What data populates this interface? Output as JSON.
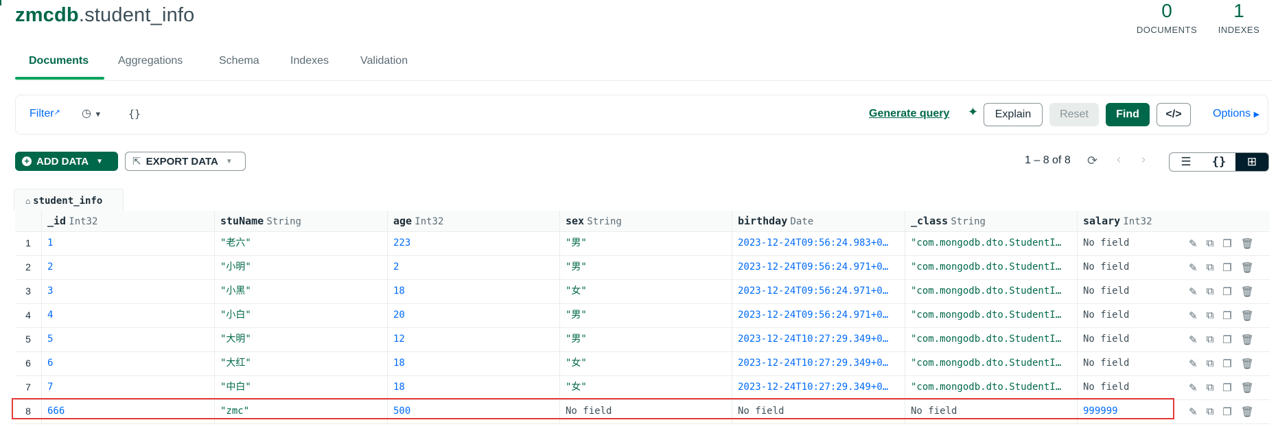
{
  "namespace": {
    "db": "zmcdb",
    "collection": ".student_info"
  },
  "stats": [
    {
      "value": "0",
      "label": "DOCUMENTS"
    },
    {
      "value": "1",
      "label": "INDEXES"
    }
  ],
  "tabs": [
    "Documents",
    "Aggregations",
    "Schema",
    "Indexes",
    "Validation"
  ],
  "query_bar": {
    "filter_label": "Filter",
    "query_text": "{}",
    "generate_label": "Generate query",
    "explain_label": "Explain",
    "reset_label": "Reset",
    "find_label": "Find",
    "code_label": "</>",
    "options_label": "Options"
  },
  "actions": {
    "add_data": "ADD DATA",
    "export_data": "EXPORT DATA",
    "pagination": "1 – 8 of 8"
  },
  "collection_tab": "student_info",
  "columns": [
    {
      "name": "_id",
      "type": "Int32"
    },
    {
      "name": "stuName",
      "type": "String"
    },
    {
      "name": "age",
      "type": "Int32"
    },
    {
      "name": "sex",
      "type": "String"
    },
    {
      "name": "birthday",
      "type": "Date"
    },
    {
      "name": "_class",
      "type": "String"
    },
    {
      "name": "salary",
      "type": "Int32"
    }
  ],
  "rows": [
    {
      "n": "1",
      "id": "1",
      "stuName": "\"老六\"",
      "age": "223",
      "sex": "\"男\"",
      "birthday": "2023-12-24T09:56:24.983+0…",
      "class": "\"com.mongodb.dto.StudentI…",
      "salary": "No field"
    },
    {
      "n": "2",
      "id": "2",
      "stuName": "\"小明\"",
      "age": "2",
      "sex": "\"男\"",
      "birthday": "2023-12-24T09:56:24.971+0…",
      "class": "\"com.mongodb.dto.StudentI…",
      "salary": "No field"
    },
    {
      "n": "3",
      "id": "3",
      "stuName": "\"小黑\"",
      "age": "18",
      "sex": "\"女\"",
      "birthday": "2023-12-24T09:56:24.971+0…",
      "class": "\"com.mongodb.dto.StudentI…",
      "salary": "No field"
    },
    {
      "n": "4",
      "id": "4",
      "stuName": "\"小白\"",
      "age": "20",
      "sex": "\"男\"",
      "birthday": "2023-12-24T09:56:24.971+0…",
      "class": "\"com.mongodb.dto.StudentI…",
      "salary": "No field"
    },
    {
      "n": "5",
      "id": "5",
      "stuName": "\"大明\"",
      "age": "12",
      "sex": "\"男\"",
      "birthday": "2023-12-24T10:27:29.349+0…",
      "class": "\"com.mongodb.dto.StudentI…",
      "salary": "No field"
    },
    {
      "n": "6",
      "id": "6",
      "stuName": "\"大红\"",
      "age": "18",
      "sex": "\"女\"",
      "birthday": "2023-12-24T10:27:29.349+0…",
      "class": "\"com.mongodb.dto.StudentI…",
      "salary": "No field"
    },
    {
      "n": "7",
      "id": "7",
      "stuName": "\"中白\"",
      "age": "18",
      "sex": "\"女\"",
      "birthday": "2023-12-24T10:27:29.349+0…",
      "class": "\"com.mongodb.dto.StudentI…",
      "salary": "No field"
    },
    {
      "n": "8",
      "id": "666",
      "stuName": "\"zmc\"",
      "age": "500",
      "sex": "No field",
      "birthday": "No field",
      "class": "No field",
      "salary": "999999"
    }
  ],
  "colors": {
    "brand": "#00684a",
    "link": "#016bf8",
    "highlight": "#e53935"
  }
}
